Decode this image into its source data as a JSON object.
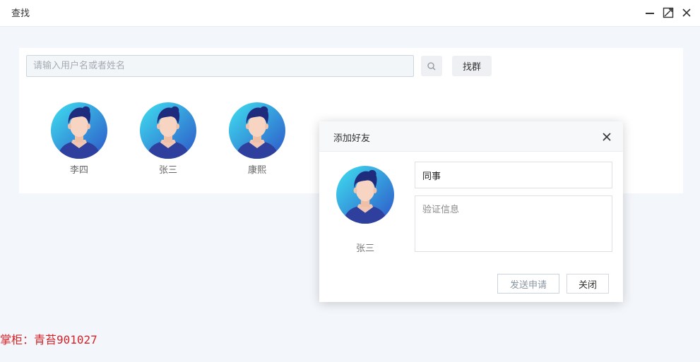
{
  "window": {
    "title": "查找",
    "controls": [
      "minimize-icon",
      "maximize-icon",
      "close-icon"
    ]
  },
  "search": {
    "placeholder": "请输入用户名或者姓名",
    "value": "",
    "search_icon": "search-icon",
    "group_button_label": "找群"
  },
  "results": [
    {
      "name": "李四",
      "avatar": "user-avatar-icon"
    },
    {
      "name": "张三",
      "avatar": "user-avatar-icon"
    },
    {
      "name": "康熙",
      "avatar": "user-avatar-icon"
    }
  ],
  "dialog": {
    "title": "添加好友",
    "close_icon": "close-icon",
    "user_name": "张三",
    "remark_value": "同事",
    "verify_placeholder": "验证信息",
    "send_label": "发送申请",
    "close_label": "关闭"
  },
  "watermark": "掌柜：青苔901027",
  "colors": {
    "background": "#f3f6fa",
    "avatar_gradient_start": "#3fe0f0",
    "avatar_gradient_end": "#2d55c8",
    "hair": "#1f2b7c",
    "watermark": "#d4242a"
  }
}
